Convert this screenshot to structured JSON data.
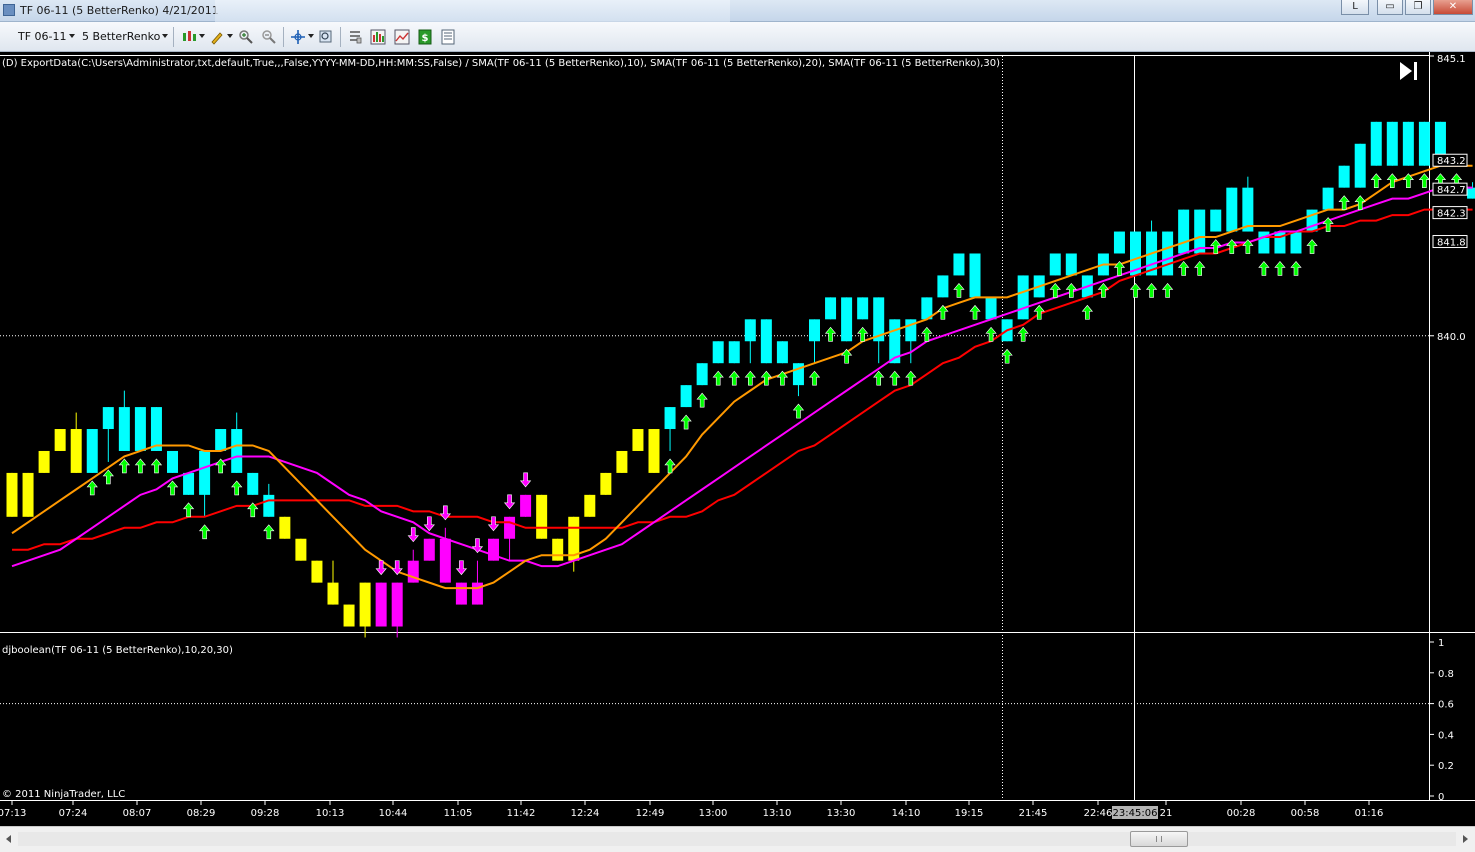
{
  "window": {
    "title": "TF 06-11 (5 BetterRenko)  4/21/2011",
    "buttons": {
      "l": "L",
      "minimize": "▭",
      "restore": "❐",
      "close": "✕"
    }
  },
  "toolbar": {
    "instrument": "TF 06-11",
    "bar_type": "5 BetterRenko",
    "icons": [
      "bar-style-icon",
      "pencil-draw-icon",
      "zoom-in-icon",
      "zoom-out-icon",
      "crosshair-icon",
      "magnifier-icon",
      "properties-icon",
      "indicators-icon",
      "strategies-icon",
      "dollar-icon",
      "data-box-icon"
    ]
  },
  "colors": {
    "up_bar": "#00ffff",
    "down_bar": "#ffff00",
    "short_bar": "#ff00ff",
    "sma10": "#ff9900",
    "sma20": "#ff00ff",
    "sma30": "#ff0000",
    "long_arrow": "#00ff00",
    "short_arrow": "#ff00ff"
  },
  "indicator_label": "(D) ExportData(C:\\Users\\Administrator,txt,default,True,,,False,YYYY-MM-DD,HH:MM:SS,False) / SMA(TF 06-11 (5 BetterRenko),10), SMA(TF 06-11 (5 BetterRenko),20), SMA(TF 06-11 (5 BetterRenko),30)",
  "lower_label": "djboolean(TF 06-11 (5 BetterRenko),10,20,30)",
  "copyright": "© 2011 NinjaTrader, LLC",
  "cursor_time": "23:45:06",
  "chart_data": {
    "type": "candlestick",
    "price_axis": {
      "ylim": [
        834.6,
        845.1
      ],
      "ticks": [
        "845.1",
        "840.0"
      ],
      "markers": [
        "843.2",
        "842.7",
        "842.3",
        "841.8"
      ],
      "hline": 840.0
    },
    "x_tick_labels": [
      "07:13",
      "07:24",
      "08:07",
      "08:29",
      "09:28",
      "10:13",
      "10:44",
      "11:05",
      "11:42",
      "12:24",
      "12:49",
      "13:00",
      "13:10",
      "13:30",
      "14:10",
      "19:15",
      "21:45",
      "22:46",
      "23:45:06",
      "21",
      "00:28",
      "00:58",
      "01:16"
    ],
    "bars": [
      {
        "o": 836.7,
        "c": 837.5,
        "h": 837.5,
        "l": 836.7,
        "color": "yellow"
      },
      {
        "o": 836.7,
        "c": 837.5,
        "h": 837.5,
        "l": 836.7,
        "color": "yellow"
      },
      {
        "o": 837.5,
        "c": 837.9,
        "h": 837.9,
        "l": 837.5,
        "color": "yellow"
      },
      {
        "o": 837.9,
        "c": 838.3,
        "h": 838.3,
        "l": 837.9,
        "color": "yellow"
      },
      {
        "o": 837.5,
        "c": 838.3,
        "h": 838.6,
        "l": 837.5,
        "color": "yellow"
      },
      {
        "o": 837.5,
        "c": 838.3,
        "h": 838.3,
        "l": 837.5,
        "color": "cyan"
      },
      {
        "o": 838.3,
        "c": 838.7,
        "h": 838.7,
        "l": 837.7,
        "color": "cyan"
      },
      {
        "o": 837.9,
        "c": 838.7,
        "h": 839.0,
        "l": 837.9,
        "color": "cyan"
      },
      {
        "o": 837.9,
        "c": 838.7,
        "h": 838.7,
        "l": 837.9,
        "color": "cyan"
      },
      {
        "o": 837.9,
        "c": 838.7,
        "h": 838.7,
        "l": 837.9,
        "color": "cyan"
      },
      {
        "o": 837.5,
        "c": 837.9,
        "h": 837.9,
        "l": 837.5,
        "color": "cyan"
      },
      {
        "o": 837.1,
        "c": 837.5,
        "h": 837.5,
        "l": 837.1,
        "color": "cyan"
      },
      {
        "o": 837.1,
        "c": 837.9,
        "h": 837.9,
        "l": 836.7,
        "color": "cyan"
      },
      {
        "o": 837.9,
        "c": 838.3,
        "h": 838.3,
        "l": 837.9,
        "color": "cyan"
      },
      {
        "o": 837.5,
        "c": 838.3,
        "h": 838.6,
        "l": 837.5,
        "color": "cyan"
      },
      {
        "o": 837.1,
        "c": 837.5,
        "h": 837.5,
        "l": 837.1,
        "color": "cyan"
      },
      {
        "o": 836.7,
        "c": 837.1,
        "h": 837.3,
        "l": 836.7,
        "color": "cyan"
      },
      {
        "o": 836.3,
        "c": 836.7,
        "h": 836.7,
        "l": 836.3,
        "color": "yellow"
      },
      {
        "o": 835.9,
        "c": 836.3,
        "h": 836.3,
        "l": 835.9,
        "color": "yellow"
      },
      {
        "o": 835.5,
        "c": 835.9,
        "h": 835.9,
        "l": 835.5,
        "color": "yellow"
      },
      {
        "o": 835.1,
        "c": 835.5,
        "h": 835.9,
        "l": 835.1,
        "color": "yellow"
      },
      {
        "o": 834.7,
        "c": 835.1,
        "h": 835.1,
        "l": 834.7,
        "color": "yellow"
      },
      {
        "o": 834.7,
        "c": 835.5,
        "h": 835.5,
        "l": 834.5,
        "color": "yellow"
      },
      {
        "o": 834.7,
        "c": 835.5,
        "h": 835.5,
        "l": 834.7,
        "color": "magenta"
      },
      {
        "o": 834.7,
        "c": 835.5,
        "h": 835.5,
        "l": 834.5,
        "color": "magenta"
      },
      {
        "o": 835.5,
        "c": 835.9,
        "h": 836.1,
        "l": 835.5,
        "color": "magenta"
      },
      {
        "o": 835.9,
        "c": 836.3,
        "h": 836.3,
        "l": 835.9,
        "color": "magenta"
      },
      {
        "o": 835.5,
        "c": 836.3,
        "h": 836.5,
        "l": 835.5,
        "color": "magenta"
      },
      {
        "o": 835.1,
        "c": 835.5,
        "h": 835.5,
        "l": 835.1,
        "color": "magenta"
      },
      {
        "o": 835.1,
        "c": 835.5,
        "h": 835.9,
        "l": 835.1,
        "color": "magenta"
      },
      {
        "o": 835.9,
        "c": 836.3,
        "h": 836.3,
        "l": 835.9,
        "color": "magenta"
      },
      {
        "o": 836.3,
        "c": 836.7,
        "h": 836.7,
        "l": 835.9,
        "color": "magenta"
      },
      {
        "o": 836.7,
        "c": 837.1,
        "h": 837.1,
        "l": 836.7,
        "color": "magenta"
      },
      {
        "o": 836.3,
        "c": 837.1,
        "h": 837.1,
        "l": 836.3,
        "color": "yellow"
      },
      {
        "o": 835.9,
        "c": 836.3,
        "h": 836.3,
        "l": 835.9,
        "color": "yellow"
      },
      {
        "o": 835.9,
        "c": 836.7,
        "h": 836.7,
        "l": 835.7,
        "color": "yellow"
      },
      {
        "o": 836.7,
        "c": 837.1,
        "h": 837.1,
        "l": 836.7,
        "color": "yellow"
      },
      {
        "o": 837.1,
        "c": 837.5,
        "h": 837.5,
        "l": 837.1,
        "color": "yellow"
      },
      {
        "o": 837.5,
        "c": 837.9,
        "h": 837.9,
        "l": 837.5,
        "color": "yellow"
      },
      {
        "o": 837.9,
        "c": 838.3,
        "h": 838.3,
        "l": 837.9,
        "color": "yellow"
      },
      {
        "o": 837.5,
        "c": 838.3,
        "h": 838.3,
        "l": 837.5,
        "color": "yellow"
      },
      {
        "o": 838.3,
        "c": 838.7,
        "h": 838.7,
        "l": 837.9,
        "color": "cyan"
      },
      {
        "o": 838.7,
        "c": 839.1,
        "h": 839.1,
        "l": 838.7,
        "color": "cyan"
      },
      {
        "o": 839.1,
        "c": 839.5,
        "h": 839.5,
        "l": 839.1,
        "color": "cyan"
      },
      {
        "o": 839.5,
        "c": 839.9,
        "h": 839.9,
        "l": 839.5,
        "color": "cyan"
      },
      {
        "o": 839.5,
        "c": 839.9,
        "h": 839.9,
        "l": 839.5,
        "color": "cyan"
      },
      {
        "o": 839.9,
        "c": 840.3,
        "h": 840.3,
        "l": 839.5,
        "color": "cyan"
      },
      {
        "o": 839.5,
        "c": 840.3,
        "h": 840.3,
        "l": 839.5,
        "color": "cyan"
      },
      {
        "o": 839.5,
        "c": 839.9,
        "h": 839.9,
        "l": 839.5,
        "color": "cyan"
      },
      {
        "o": 839.1,
        "c": 839.5,
        "h": 839.5,
        "l": 838.9,
        "color": "cyan"
      },
      {
        "o": 839.9,
        "c": 840.3,
        "h": 840.3,
        "l": 839.5,
        "color": "cyan"
      },
      {
        "o": 840.3,
        "c": 840.7,
        "h": 840.7,
        "l": 840.3,
        "color": "cyan"
      },
      {
        "o": 839.9,
        "c": 840.7,
        "h": 840.7,
        "l": 839.9,
        "color": "cyan"
      },
      {
        "o": 840.3,
        "c": 840.7,
        "h": 840.7,
        "l": 840.3,
        "color": "cyan"
      },
      {
        "o": 839.9,
        "c": 840.7,
        "h": 840.7,
        "l": 839.5,
        "color": "cyan"
      },
      {
        "o": 839.5,
        "c": 840.3,
        "h": 840.3,
        "l": 839.5,
        "color": "cyan"
      },
      {
        "o": 839.9,
        "c": 840.3,
        "h": 840.3,
        "l": 839.5,
        "color": "cyan"
      },
      {
        "o": 840.3,
        "c": 840.7,
        "h": 840.7,
        "l": 840.3,
        "color": "cyan"
      },
      {
        "o": 840.7,
        "c": 841.1,
        "h": 841.1,
        "l": 840.7,
        "color": "cyan"
      },
      {
        "o": 841.1,
        "c": 841.5,
        "h": 841.5,
        "l": 841.1,
        "color": "cyan"
      },
      {
        "o": 840.7,
        "c": 841.5,
        "h": 841.5,
        "l": 840.7,
        "color": "cyan"
      },
      {
        "o": 840.3,
        "c": 840.7,
        "h": 840.7,
        "l": 840.3,
        "color": "cyan"
      },
      {
        "o": 839.9,
        "c": 840.3,
        "h": 840.3,
        "l": 839.9,
        "color": "cyan"
      },
      {
        "o": 840.3,
        "c": 841.1,
        "h": 841.1,
        "l": 840.3,
        "color": "cyan"
      },
      {
        "o": 840.7,
        "c": 841.1,
        "h": 841.1,
        "l": 840.7,
        "color": "cyan"
      },
      {
        "o": 841.1,
        "c": 841.5,
        "h": 841.5,
        "l": 841.1,
        "color": "cyan"
      },
      {
        "o": 841.1,
        "c": 841.5,
        "h": 841.5,
        "l": 841.1,
        "color": "cyan"
      },
      {
        "o": 840.7,
        "c": 841.1,
        "h": 841.1,
        "l": 840.7,
        "color": "cyan"
      },
      {
        "o": 841.1,
        "c": 841.5,
        "h": 841.5,
        "l": 841.1,
        "color": "cyan"
      },
      {
        "o": 841.5,
        "c": 841.9,
        "h": 841.9,
        "l": 841.5,
        "color": "cyan"
      },
      {
        "o": 841.1,
        "c": 841.9,
        "h": 841.9,
        "l": 841.1,
        "color": "cyan"
      },
      {
        "o": 841.1,
        "c": 841.9,
        "h": 842.1,
        "l": 841.1,
        "color": "cyan"
      },
      {
        "o": 841.1,
        "c": 841.9,
        "h": 841.9,
        "l": 841.1,
        "color": "cyan"
      },
      {
        "o": 841.5,
        "c": 842.3,
        "h": 842.3,
        "l": 841.5,
        "color": "cyan"
      },
      {
        "o": 841.5,
        "c": 842.3,
        "h": 842.3,
        "l": 841.5,
        "color": "cyan"
      },
      {
        "o": 841.9,
        "c": 842.3,
        "h": 842.3,
        "l": 841.9,
        "color": "cyan"
      },
      {
        "o": 841.9,
        "c": 842.7,
        "h": 842.7,
        "l": 841.9,
        "color": "cyan"
      },
      {
        "o": 841.9,
        "c": 842.7,
        "h": 842.9,
        "l": 841.9,
        "color": "cyan"
      },
      {
        "o": 841.5,
        "c": 841.9,
        "h": 841.9,
        "l": 841.5,
        "color": "cyan"
      },
      {
        "o": 841.5,
        "c": 841.9,
        "h": 841.9,
        "l": 841.5,
        "color": "cyan"
      },
      {
        "o": 841.5,
        "c": 841.9,
        "h": 841.9,
        "l": 841.5,
        "color": "cyan"
      },
      {
        "o": 841.9,
        "c": 842.3,
        "h": 842.3,
        "l": 841.9,
        "color": "cyan"
      },
      {
        "o": 842.3,
        "c": 842.7,
        "h": 842.7,
        "l": 842.3,
        "color": "cyan"
      },
      {
        "o": 842.7,
        "c": 843.1,
        "h": 843.1,
        "l": 842.7,
        "color": "cyan"
      },
      {
        "o": 842.7,
        "c": 843.5,
        "h": 843.5,
        "l": 842.7,
        "color": "cyan"
      },
      {
        "o": 843.1,
        "c": 843.9,
        "h": 843.9,
        "l": 843.1,
        "color": "cyan"
      },
      {
        "o": 843.1,
        "c": 843.9,
        "h": 843.9,
        "l": 843.1,
        "color": "cyan"
      },
      {
        "o": 843.1,
        "c": 843.9,
        "h": 843.9,
        "l": 843.1,
        "color": "cyan"
      },
      {
        "o": 843.1,
        "c": 843.9,
        "h": 843.9,
        "l": 843.1,
        "color": "cyan"
      },
      {
        "o": 843.1,
        "c": 843.9,
        "h": 843.9,
        "l": 843.1,
        "color": "cyan"
      },
      {
        "o": 843.1,
        "c": 843.2,
        "h": 843.3,
        "l": 843.1,
        "color": "cyan"
      },
      {
        "o": 842.5,
        "c": 842.7,
        "h": 842.8,
        "l": 842.5,
        "color": "cyan"
      },
      {
        "o": 841.9,
        "c": 842.3,
        "h": 842.3,
        "l": 841.9,
        "color": "cyan"
      }
    ],
    "long_arrow_bars": [
      5,
      6,
      7,
      8,
      9,
      10,
      11,
      12,
      13,
      14,
      15,
      16,
      41,
      42,
      43,
      44,
      45,
      46,
      47,
      48,
      49,
      50,
      51,
      52,
      53,
      54,
      55,
      56,
      57,
      58,
      59,
      60,
      61,
      62,
      63,
      64,
      65,
      66,
      67,
      68,
      69,
      70,
      71,
      72,
      73,
      74,
      75,
      76,
      77,
      78,
      79,
      80,
      81,
      82,
      83,
      84,
      85,
      86,
      87,
      88,
      89,
      90,
      92,
      93,
      94,
      95
    ],
    "short_arrow_bars": [
      23,
      24,
      25,
      26,
      27,
      28,
      29,
      30,
      31,
      32
    ],
    "sma10": [
      836.4,
      836.6,
      836.8,
      837.0,
      837.2,
      837.4,
      837.6,
      837.8,
      837.9,
      838.0,
      838.0,
      838.0,
      837.9,
      837.9,
      838.0,
      838.0,
      837.9,
      837.6,
      837.3,
      837.0,
      836.7,
      836.4,
      836.1,
      835.9,
      835.7,
      835.6,
      835.5,
      835.4,
      835.4,
      835.4,
      835.5,
      835.7,
      835.9,
      836.0,
      836.0,
      836.0,
      836.1,
      836.3,
      836.6,
      836.9,
      837.2,
      837.5,
      837.8,
      838.2,
      838.5,
      838.8,
      839.0,
      839.2,
      839.3,
      839.4,
      839.5,
      839.6,
      839.7,
      839.9,
      840.0,
      840.1,
      840.2,
      840.3,
      840.5,
      840.6,
      840.7,
      840.7,
      840.7,
      840.8,
      840.9,
      841.0,
      841.1,
      841.2,
      841.3,
      841.3,
      841.4,
      841.5,
      841.6,
      841.7,
      841.8,
      841.8,
      841.9,
      842.0,
      842.0,
      842.0,
      842.1,
      842.2,
      842.3,
      842.3,
      842.4,
      842.6,
      842.8,
      842.9,
      843.0,
      843.1,
      843.1,
      843.1
    ],
    "sma20": [
      835.8,
      835.9,
      836.0,
      836.1,
      836.3,
      836.5,
      836.7,
      836.9,
      837.1,
      837.2,
      837.4,
      837.5,
      837.6,
      837.7,
      837.8,
      837.8,
      837.8,
      837.7,
      837.6,
      837.5,
      837.3,
      837.1,
      837.0,
      836.8,
      836.7,
      836.6,
      836.4,
      836.3,
      836.2,
      836.1,
      836.0,
      835.9,
      835.9,
      835.8,
      835.8,
      835.9,
      836.0,
      836.1,
      836.2,
      836.4,
      836.6,
      836.8,
      837.0,
      837.2,
      837.4,
      837.6,
      837.8,
      838.0,
      838.2,
      838.4,
      838.6,
      838.8,
      839.0,
      839.2,
      839.4,
      839.6,
      839.7,
      839.9,
      840.0,
      840.1,
      840.2,
      840.3,
      840.4,
      840.5,
      840.6,
      840.7,
      840.8,
      840.9,
      841.0,
      841.1,
      841.2,
      841.3,
      841.4,
      841.5,
      841.6,
      841.6,
      841.7,
      841.7,
      841.8,
      841.9,
      841.9,
      842.0,
      842.1,
      842.2,
      842.3,
      842.4,
      842.5,
      842.5,
      842.6,
      842.7,
      842.7,
      842.7
    ],
    "sma30": [
      836.1,
      836.1,
      836.2,
      836.2,
      836.3,
      836.3,
      836.4,
      836.5,
      836.5,
      836.6,
      836.6,
      836.7,
      836.7,
      836.8,
      836.9,
      836.9,
      837.0,
      837.0,
      837.0,
      837.0,
      837.0,
      837.0,
      836.9,
      836.9,
      836.9,
      836.8,
      836.8,
      836.7,
      836.7,
      836.7,
      836.6,
      836.6,
      836.5,
      836.5,
      836.5,
      836.5,
      836.5,
      836.5,
      836.5,
      836.6,
      836.6,
      836.7,
      836.7,
      836.8,
      837.0,
      837.1,
      837.3,
      837.5,
      837.7,
      837.9,
      838.0,
      838.2,
      838.4,
      838.6,
      838.8,
      839.0,
      839.1,
      839.3,
      839.5,
      839.6,
      839.8,
      839.9,
      840.1,
      840.2,
      840.4,
      840.5,
      840.6,
      840.7,
      840.8,
      841.0,
      841.1,
      841.2,
      841.3,
      841.4,
      841.5,
      841.5,
      841.6,
      841.7,
      841.8,
      841.8,
      841.9,
      841.9,
      842.0,
      842.0,
      842.1,
      842.1,
      842.2,
      842.2,
      842.3,
      842.3,
      842.3,
      842.3
    ],
    "lower_panel": {
      "ylim": [
        0,
        1
      ],
      "ticks": [
        "1",
        "0.8",
        "0.6",
        "0.4",
        "0.2",
        "0"
      ],
      "hline": 0.6
    }
  }
}
